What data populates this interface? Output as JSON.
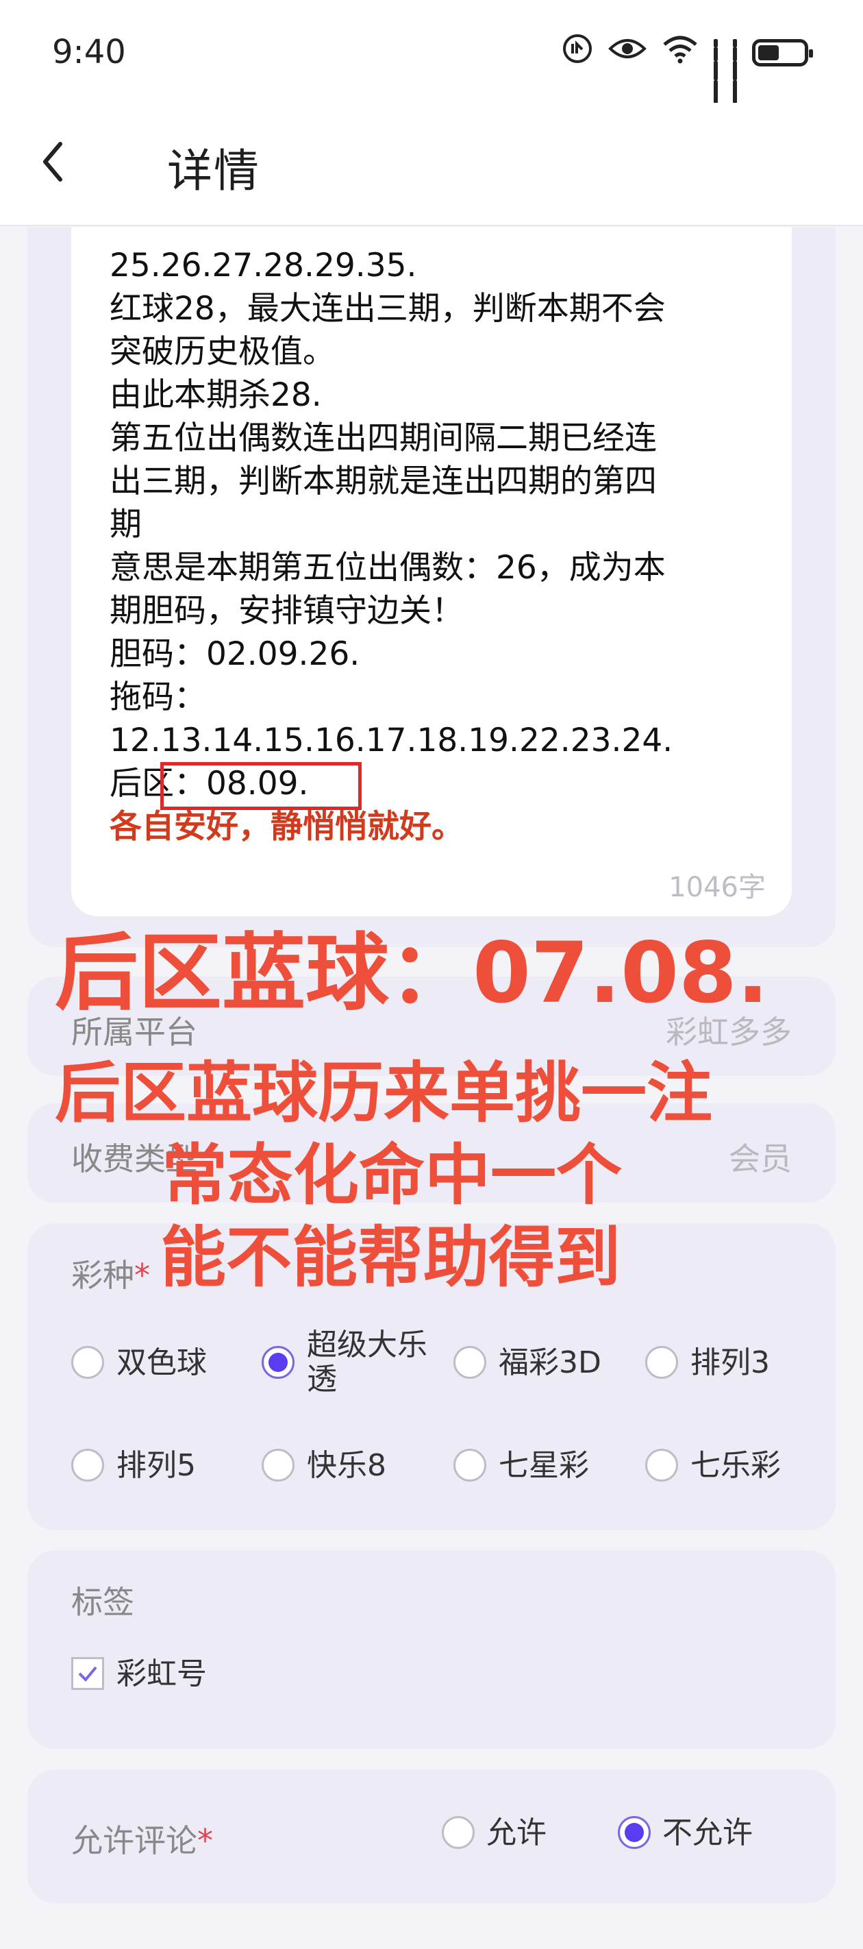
{
  "status": {
    "time": "9:40"
  },
  "nav": {
    "title": "详情"
  },
  "content": {
    "lines": [
      "25.26.27.28.29.35.",
      "红球28，最大连出三期，判断本期不会",
      "突破历史极值。",
      "由此本期杀28.",
      "第五位出偶数连出四期间隔二期已经连",
      "出三期，判断本期就是连出四期的第四",
      "期",
      "意思是本期第五位出偶数：26，成为本",
      "期胆码，安排镇守边关！",
      "胆码：02.09.26.",
      "拖码：",
      "12.13.14.15.16.17.18.19.22.23.24.",
      "后区：08.09."
    ],
    "closing": "各自安好，静悄悄就好。",
    "word_count": "1046字"
  },
  "platform": {
    "label": "所属平台",
    "value": "彩虹多多"
  },
  "fee": {
    "label": "收费类型",
    "value": "会员"
  },
  "lottery": {
    "label": "彩种",
    "required_mark": "*",
    "options": [
      "双色球",
      "超级大乐透",
      "福彩3D",
      "排列3",
      "排列5",
      "快乐8",
      "七星彩",
      "七乐彩"
    ],
    "option_line2": "透",
    "selected": "超级大乐透"
  },
  "tags": {
    "label": "标签",
    "items": [
      "彩虹号"
    ]
  },
  "comment": {
    "label": "允许评论",
    "required_mark": "*",
    "options": [
      "允许",
      "不允许"
    ],
    "selected": "不允许"
  },
  "overlay": {
    "line1": "后区蓝球：07.08.",
    "line2": "后区蓝球历来单挑一注",
    "line3": "常态化命中一个",
    "line4": "能不能帮助得到"
  },
  "colors": {
    "accent": "#5B3CF0",
    "overlay_red": "#EE4F3A",
    "closing_red": "#D23A1E",
    "card_bg": "#EDEBF5"
  }
}
